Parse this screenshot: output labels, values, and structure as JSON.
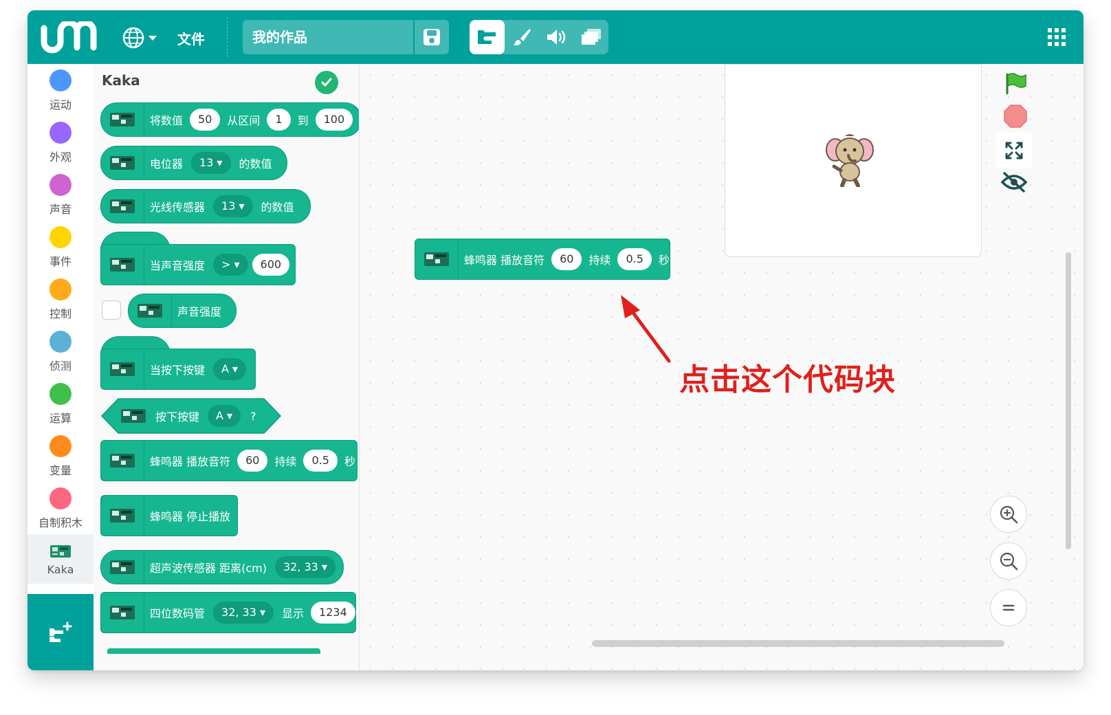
{
  "topbar": {
    "file_menu": "文件",
    "project_title": "我的作品"
  },
  "categories": [
    {
      "label": "运动",
      "color": "#4c97ff"
    },
    {
      "label": "外观",
      "color": "#9966ff"
    },
    {
      "label": "声音",
      "color": "#cf63cf"
    },
    {
      "label": "事件",
      "color": "#ffd500"
    },
    {
      "label": "控制",
      "color": "#ffab19"
    },
    {
      "label": "侦测",
      "color": "#5cb1d6"
    },
    {
      "label": "运算",
      "color": "#40bf4a"
    },
    {
      "label": "变量",
      "color": "#ff8c1a"
    },
    {
      "label": "自制积木",
      "color": "#ff6680"
    },
    {
      "label": "Kaka",
      "icon": "circuit-board-icon"
    }
  ],
  "palette": {
    "title": "Kaka",
    "blocks": {
      "map": {
        "t1": "将数值",
        "v1": "50",
        "t2": "从区间",
        "v2": "1",
        "t3": "到",
        "v3": "100"
      },
      "pot": {
        "t1": "电位器",
        "pin": "13",
        "t2": "的数值"
      },
      "light": {
        "t1": "光线传感器",
        "pin": "13",
        "t2": "的数值"
      },
      "sound_hat": {
        "t1": "当声音强度",
        "op": ">",
        "val": "600"
      },
      "sound": {
        "t1": "声音强度"
      },
      "btn_hat": {
        "t1": "当按下按键",
        "key": "A"
      },
      "btn_bool": {
        "t1": "按下按键",
        "key": "A",
        "q": "?"
      },
      "buzz": {
        "t1": "蜂鸣器 播放音符",
        "note": "60",
        "t2": "持续",
        "dur": "0.5",
        "t3": "秒"
      },
      "buzz_stop": {
        "t1": "蜂鸣器 停止播放"
      },
      "ultra": {
        "t1": "超声波传感器 距离(cm)",
        "pins": "32, 33"
      },
      "seg": {
        "t1": "四位数码管",
        "pins": "32, 33",
        "t2": "显示",
        "val": "1234"
      }
    }
  },
  "workspace": {
    "block": {
      "t1": "蜂鸣器 播放音符",
      "note": "60",
      "t2": "持续",
      "dur": "0.5",
      "t3": "秒"
    },
    "annotation": "点击这个代码块",
    "accent_red": "#e0201c"
  },
  "colors": {
    "brand": "#00a19a",
    "block": "#16b690"
  }
}
